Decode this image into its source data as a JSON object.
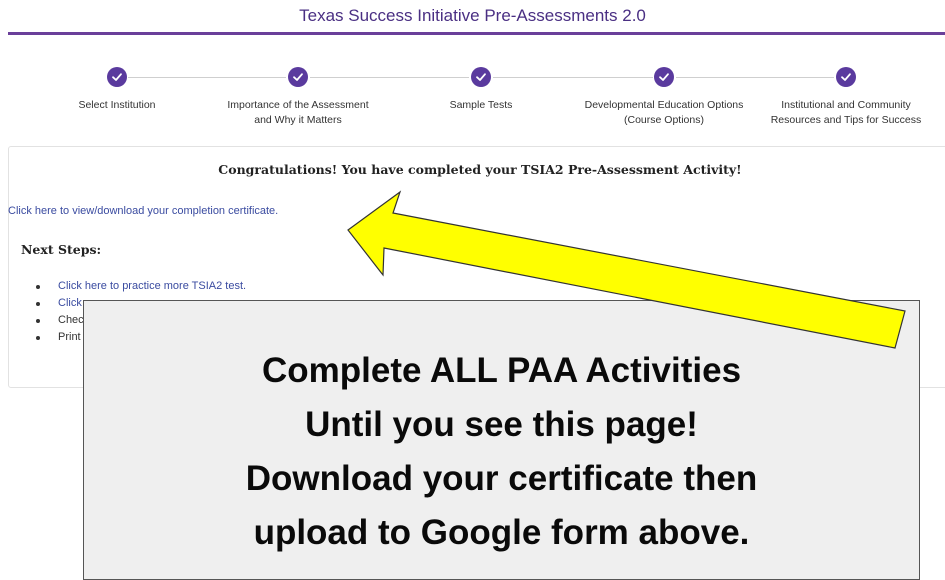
{
  "header": {
    "title": "Texas Success Initiative Pre-Assessments 2.0"
  },
  "stepper": {
    "steps": [
      {
        "line1": "Select Institution",
        "line2": ""
      },
      {
        "line1": "Importance of the Assessment",
        "line2": "and Why it Matters"
      },
      {
        "line1": "Sample Tests",
        "line2": ""
      },
      {
        "line1": "Developmental Education Options",
        "line2": "(Course Options)"
      },
      {
        "line1": "Institutional and Community",
        "line2": "Resources and Tips for Success"
      }
    ],
    "completed_icon": "check-icon"
  },
  "main": {
    "congrats": "Congratulations! You have completed your TSIA2 Pre-Assessment Activity!",
    "certificate_link": "Click here to view/download your completion certificate.",
    "next_steps_heading": "Next Steps:",
    "next_steps": [
      "Click here to practice more TSIA2 test.",
      "Click",
      "Chec",
      "Print"
    ]
  },
  "overlay": {
    "lines": [
      "Complete ALL PAA Activities",
      "Until you see this page!",
      "Download your certificate then",
      "upload to Google form above."
    ]
  },
  "colors": {
    "brand_purple": "#5a3a9e",
    "link_blue": "#3a4ba0",
    "arrow_yellow": "#ffff00"
  }
}
